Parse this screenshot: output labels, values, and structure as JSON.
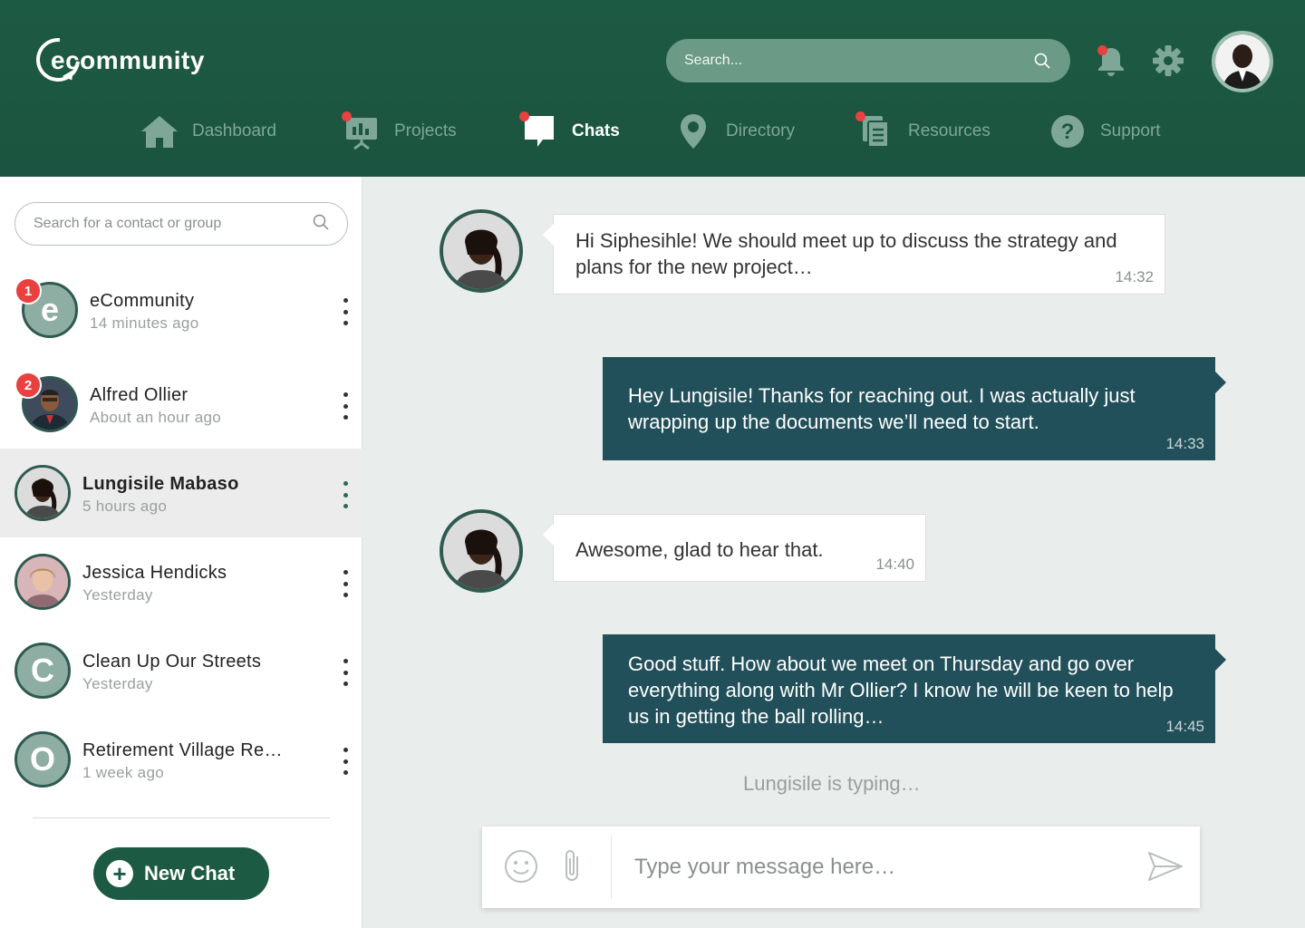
{
  "app": {
    "logo_text": "ecommunity"
  },
  "header": {
    "search_placeholder": "Search...",
    "notifications_unread": true
  },
  "nav": [
    {
      "label": "Dashboard",
      "icon": "home-icon",
      "active": false,
      "dot": false
    },
    {
      "label": "Projects",
      "icon": "presentation-icon",
      "active": false,
      "dot": true
    },
    {
      "label": "Chats",
      "icon": "chat-bubble-icon",
      "active": true,
      "dot": true
    },
    {
      "label": "Directory",
      "icon": "location-pin-icon",
      "active": false,
      "dot": false
    },
    {
      "label": "Resources",
      "icon": "documents-icon",
      "active": false,
      "dot": true
    },
    {
      "label": "Support",
      "icon": "question-icon",
      "active": false,
      "dot": false
    }
  ],
  "sidebar": {
    "search_placeholder": "Search for a contact or group",
    "contacts": [
      {
        "name": "eCommunity",
        "time": "14 minutes ago",
        "avatar_letter": "e",
        "badge": "1",
        "selected": false
      },
      {
        "name": "Alfred Ollier",
        "time": "About an hour ago",
        "avatar_letter": "",
        "badge": "2",
        "selected": false
      },
      {
        "name": "Lungisile Mabaso",
        "time": "5 hours ago",
        "avatar_letter": "",
        "badge": "",
        "selected": true
      },
      {
        "name": "Jessica Hendicks",
        "time": "Yesterday",
        "avatar_letter": "",
        "badge": "",
        "selected": false
      },
      {
        "name": "Clean Up Our Streets",
        "time": "Yesterday",
        "avatar_letter": "C",
        "badge": "",
        "selected": false
      },
      {
        "name": "Retirement Village Re…",
        "time": "1 week ago",
        "avatar_letter": "O",
        "badge": "",
        "selected": false
      }
    ],
    "new_chat_label": "New Chat"
  },
  "chat": {
    "messages": [
      {
        "direction": "in",
        "text": "Hi Siphesihle! We should meet up to discuss the strategy and plans for the new project…",
        "time": "14:32"
      },
      {
        "direction": "out",
        "text": "Hey Lungisile! Thanks for reaching out. I was actually just wrapping up the documents we’ll need to start.",
        "time": "14:33"
      },
      {
        "direction": "in",
        "text": "Awesome, glad to hear that.",
        "time": "14:40"
      },
      {
        "direction": "out",
        "text": "Good stuff. How about we meet on Thursday and go over everything along with Mr Ollier? I know he will be keen to help us in getting the ball rolling…",
        "time": "14:45"
      }
    ],
    "typing_indicator": "Lungisile is typing…",
    "composer_placeholder": "Type your message here…"
  },
  "colors": {
    "header_green": "#1d5a43",
    "outgoing_bubble": "#22505a",
    "badge_red": "#e8413f",
    "avatar_ring": "#2e5a50"
  }
}
